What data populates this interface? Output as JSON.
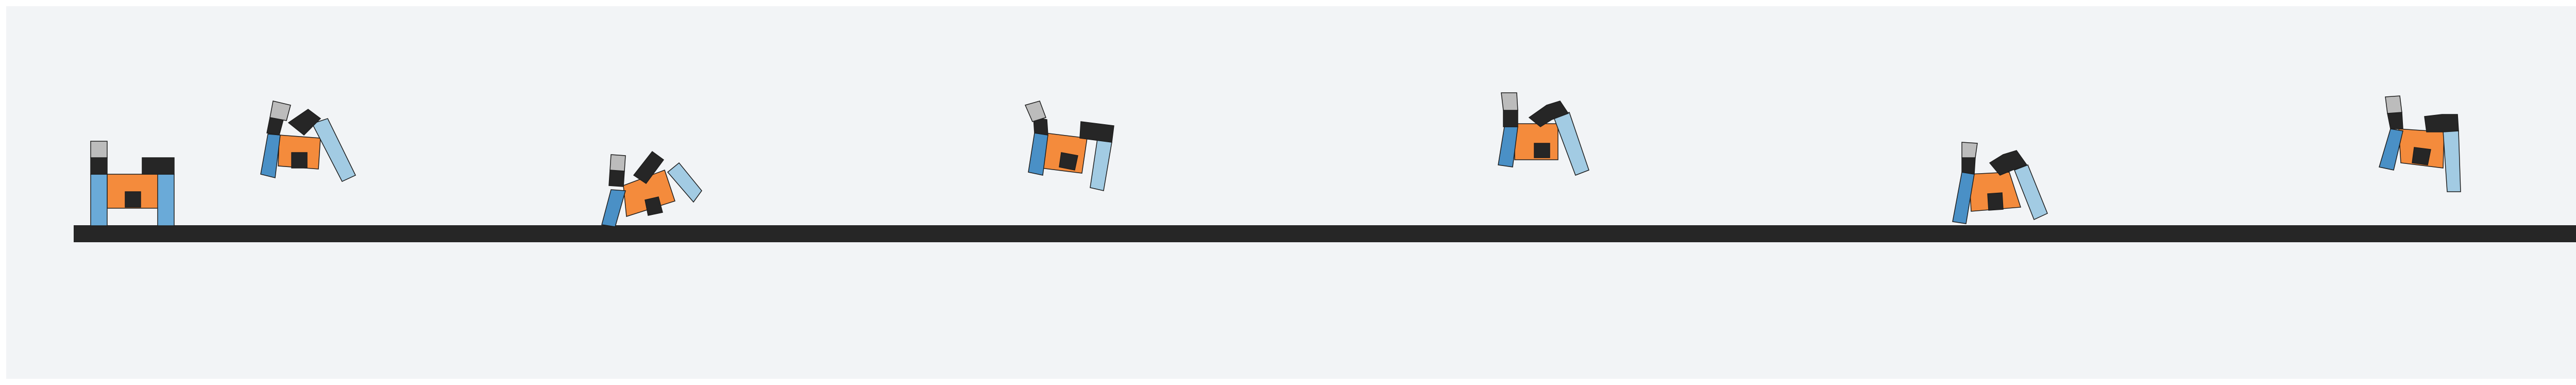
{
  "colors": {
    "background": "#f2f4f6",
    "ground": "#262626",
    "body": "#f48b3c",
    "body_light": "#f7a45e",
    "leg_blue": "#4a90c6",
    "leg_blue_light": "#a2cbe3",
    "joint": "#262626",
    "foot": "#bcbcbc",
    "outline": "#1e1e1e"
  },
  "scene": {
    "poses": [
      {
        "name": "pose-1-standing"
      },
      {
        "name": "pose-2"
      },
      {
        "name": "pose-3"
      },
      {
        "name": "pose-4"
      },
      {
        "name": "pose-5"
      },
      {
        "name": "pose-6"
      },
      {
        "name": "pose-7"
      }
    ]
  }
}
